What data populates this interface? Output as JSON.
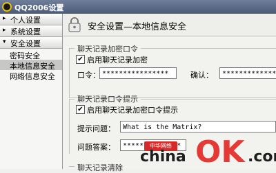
{
  "window": {
    "title": "QQ2006设置"
  },
  "sidebar": {
    "sections": [
      {
        "label": "个人设置",
        "arrow": "▸"
      },
      {
        "label": "系统设置",
        "arrow": "▸"
      },
      {
        "label": "安全设置",
        "arrow": "▾"
      }
    ],
    "items": [
      {
        "label": "密码安全",
        "active": false
      },
      {
        "label": "本地信息安全",
        "active": true
      },
      {
        "label": "网络信息安全",
        "active": false
      }
    ]
  },
  "panel": {
    "title": "安全设置—本地信息安全"
  },
  "chat_password": {
    "group_title": "聊天记录加密口令",
    "enable_checkbox": {
      "checked": true,
      "mark": "✔",
      "label": "启用聊天记录加密"
    },
    "password": {
      "label": "口令：",
      "value": "****************"
    },
    "confirm": {
      "label": "确认：",
      "value": "****************"
    }
  },
  "password_hint": {
    "group_title": "聊天记录口令提示",
    "enable_checkbox": {
      "checked": true,
      "mark": "✔",
      "label": "启用聊天记录加密口令提示"
    },
    "question": {
      "label": "提示问题：",
      "value": "What is the Matrix?"
    },
    "answer": {
      "label": "问题答案：",
      "value": "**************"
    }
  },
  "clear_history": {
    "group_title": "聊天记录清除"
  },
  "watermark": {
    "seal": "中华网络",
    "china": "china",
    "ok": "OK",
    "com": ".com"
  }
}
